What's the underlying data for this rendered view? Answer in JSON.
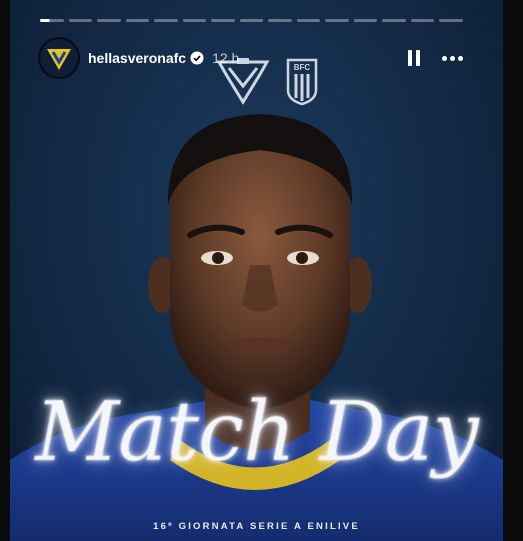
{
  "story": {
    "progress": {
      "segments": 15,
      "active_index": 0,
      "active_fraction": 0.4
    },
    "account": {
      "username": "hellasveronafc",
      "time": "12 h",
      "verified": true
    },
    "controls": {
      "pause_icon": "pause-icon",
      "more_icon": "more-horizontal-icon"
    },
    "crests": [
      "hellas-verona-crest",
      "bologna-fc-crest"
    ],
    "crest_text": {
      "bologna": "BFC",
      "bologna_year": "1909"
    },
    "headline": "Match Day",
    "subtitle": "16ª GIORNATA SERIE A ENILIVE",
    "colors": {
      "background": "#0b0b0b",
      "story_bg": "#142c4a",
      "kit_blue": "#1d3f9a",
      "kit_yellow": "#e8c21c"
    }
  }
}
